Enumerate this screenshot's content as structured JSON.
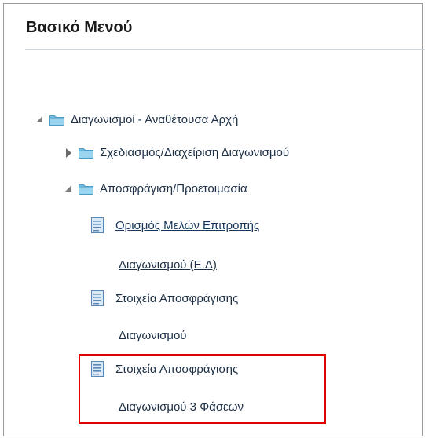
{
  "panel": {
    "title": "Βασικό Μενού"
  },
  "tree": {
    "root": {
      "label": "Διαγωνισμοί - Αναθέτουσα Αρχή",
      "icon": "folder-icon",
      "state": "expanded"
    },
    "planning": {
      "label": "Σχεδιασμός/Διαχείριση Διαγωνισμού",
      "icon": "folder-icon",
      "state": "collapsed"
    },
    "unsealing": {
      "label": "Αποσφράγιση/Προετοιμασία",
      "icon": "folder-icon",
      "state": "expanded"
    },
    "items": [
      {
        "line1": "Ορισμός Μελών Επιτροπής",
        "line2": "Διαγωνισμού (Ε.Δ)",
        "icon": "document-icon",
        "link": true
      },
      {
        "line1": "Στοιχεία Αποσφράγισης",
        "line2": "Διαγωνισμού",
        "icon": "document-icon",
        "link": false
      },
      {
        "line1": "Στοιχεία Αποσφράγισης",
        "line2": "Διαγωνισμού 3 Φάσεων",
        "icon": "document-icon",
        "link": false,
        "highlighted": true
      }
    ]
  },
  "colors": {
    "highlight_border": "#e00000",
    "folder": "#7ec3e6",
    "text": "#1c2f45"
  }
}
